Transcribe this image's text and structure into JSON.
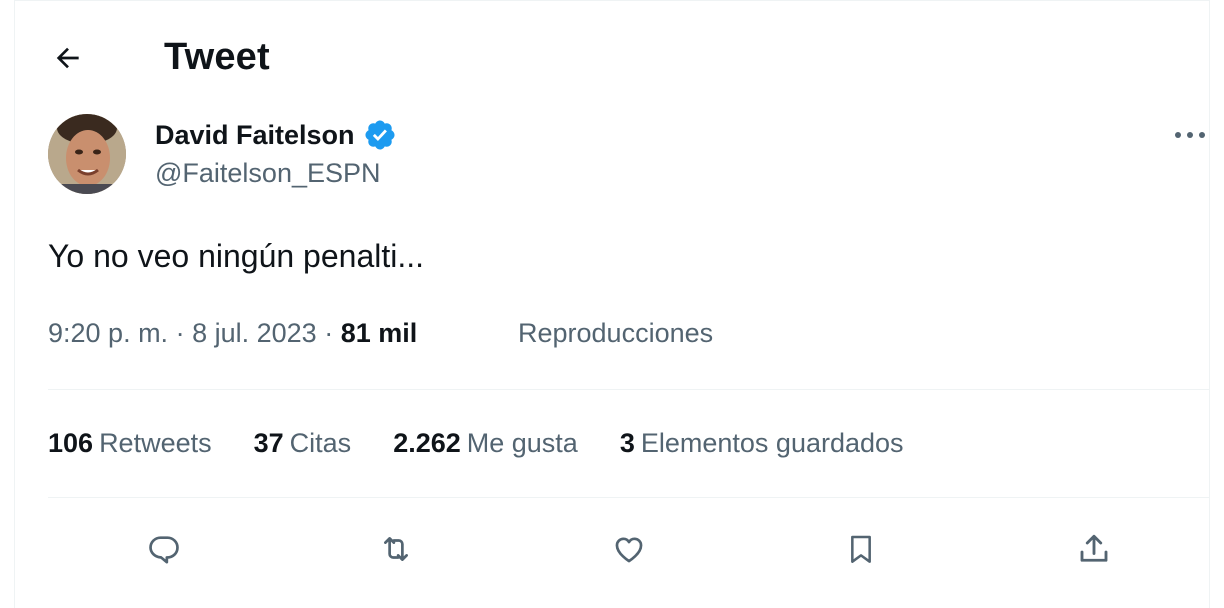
{
  "header": {
    "title": "Tweet",
    "back_icon": "arrow-left-icon"
  },
  "author": {
    "name": "David Faitelson",
    "handle": "@Faitelson_ESPN",
    "verified_color": "#1d9bf0"
  },
  "tweet": {
    "text": "Yo no veo ningún penalti...",
    "time": "9:20 p. m.",
    "separator": " · ",
    "date": "8 jul. 2023",
    "views_count": "81 mil",
    "views_label": "Reproducciones"
  },
  "stats": [
    {
      "num": "106",
      "label": "Retweets"
    },
    {
      "num": "37",
      "label": "Citas"
    },
    {
      "num": "2.262",
      "label": "Me gusta"
    },
    {
      "num": "3",
      "label": "Elementos guardados"
    }
  ],
  "actions": [
    "reply-icon",
    "retweet-icon",
    "like-icon",
    "bookmark-icon",
    "share-icon"
  ],
  "colors": {
    "text": "#0f1419",
    "secondary": "#536471",
    "divider": "#eff3f4",
    "accent": "#1d9bf0"
  }
}
